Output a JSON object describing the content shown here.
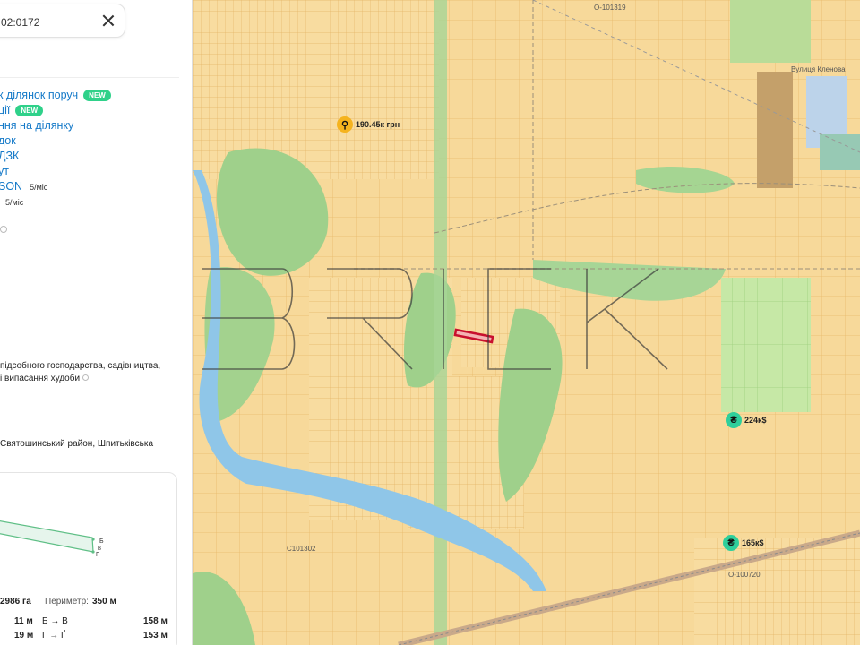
{
  "search": {
    "value": "02:0172"
  },
  "menu": [
    {
      "label": "к ділянок поруч",
      "badge": "NEW"
    },
    {
      "label": "ції",
      "badge": "NEW"
    },
    {
      "label": "ння на ділянку"
    },
    {
      "label": "док"
    },
    {
      "label": "ДЗК"
    },
    {
      "label": "ут"
    },
    {
      "label": "SON",
      "price": "5/міс"
    },
    {
      "label": "",
      "price": "5/міс"
    }
  ],
  "purpose": {
    "line1": "підсобного господарства, садівництва,",
    "line2": "і випасання худоби"
  },
  "address": "Святошинський район, Шпитьківська",
  "geometry": {
    "vertex_b": "Б",
    "vertex_v": "В",
    "vertex_g": "Г"
  },
  "stats": {
    "area": "2986 га",
    "perimeter_label": "Периметр:",
    "perimeter_value": "350 м",
    "row1_left": "11 м",
    "row1_mid": "Б → В",
    "row1_right": "158 м",
    "row2_left": "19 м",
    "row2_mid": "Г → Ґ",
    "row2_right": "153 м"
  },
  "map": {
    "markers": [
      {
        "label": "190.45к грн",
        "icon": "person-icon",
        "color": "#f5b31e"
      },
      {
        "label": "224к$",
        "icon": "hryvnia-icon",
        "color": "#2ecf9b"
      },
      {
        "label": "165к$",
        "icon": "hryvnia-icon",
        "color": "#2ecf9b"
      }
    ],
    "roads": [
      "О-101319",
      "Вулиця Кленова",
      "С101302",
      "О-100720"
    ],
    "watermark": "BRICK",
    "colors": {
      "parcel": "#f7d99a",
      "forest": "#9fcf8a",
      "water": "#8fc6e8",
      "selected": "#c8102e"
    }
  }
}
